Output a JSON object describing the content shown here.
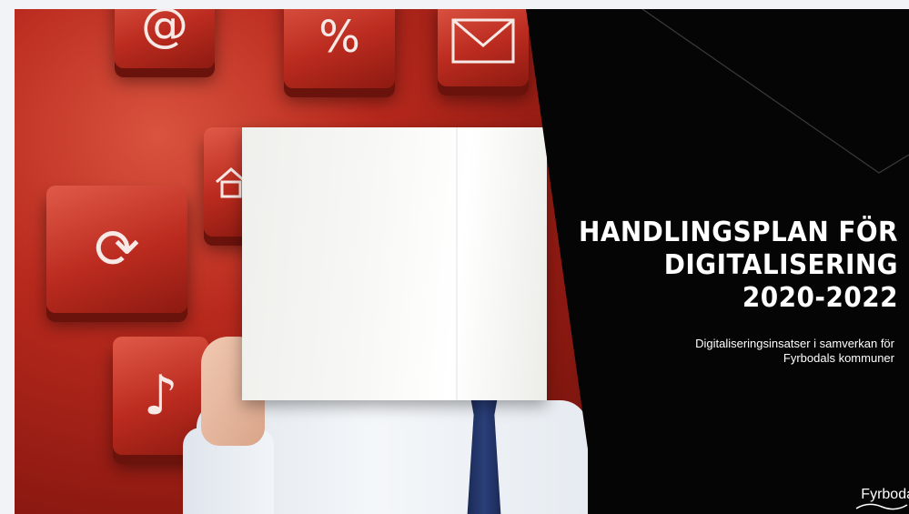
{
  "slide": {
    "title_lines": [
      "HANDLINGSPLAN FÖR",
      "DIGITALISERING",
      "2020-2022"
    ],
    "subtitle_lines": [
      "Digitaliseringsinsatser i samverkan för",
      "Fyrbodals kommuner"
    ],
    "logo_text": "Fyrboda"
  },
  "photo": {
    "key_symbols": [
      "@",
      "%",
      "⟳",
      "♪"
    ],
    "icons": [
      "at-key-icon",
      "percent-key-icon",
      "mail-key-icon",
      "sync-key-icon",
      "home-key-icon",
      "music-key-icon"
    ]
  },
  "colors": {
    "background_dark": "#050505",
    "photo_red": "#b8291d",
    "text": "#ffffff",
    "tie_blue": "#2a3f7a"
  }
}
